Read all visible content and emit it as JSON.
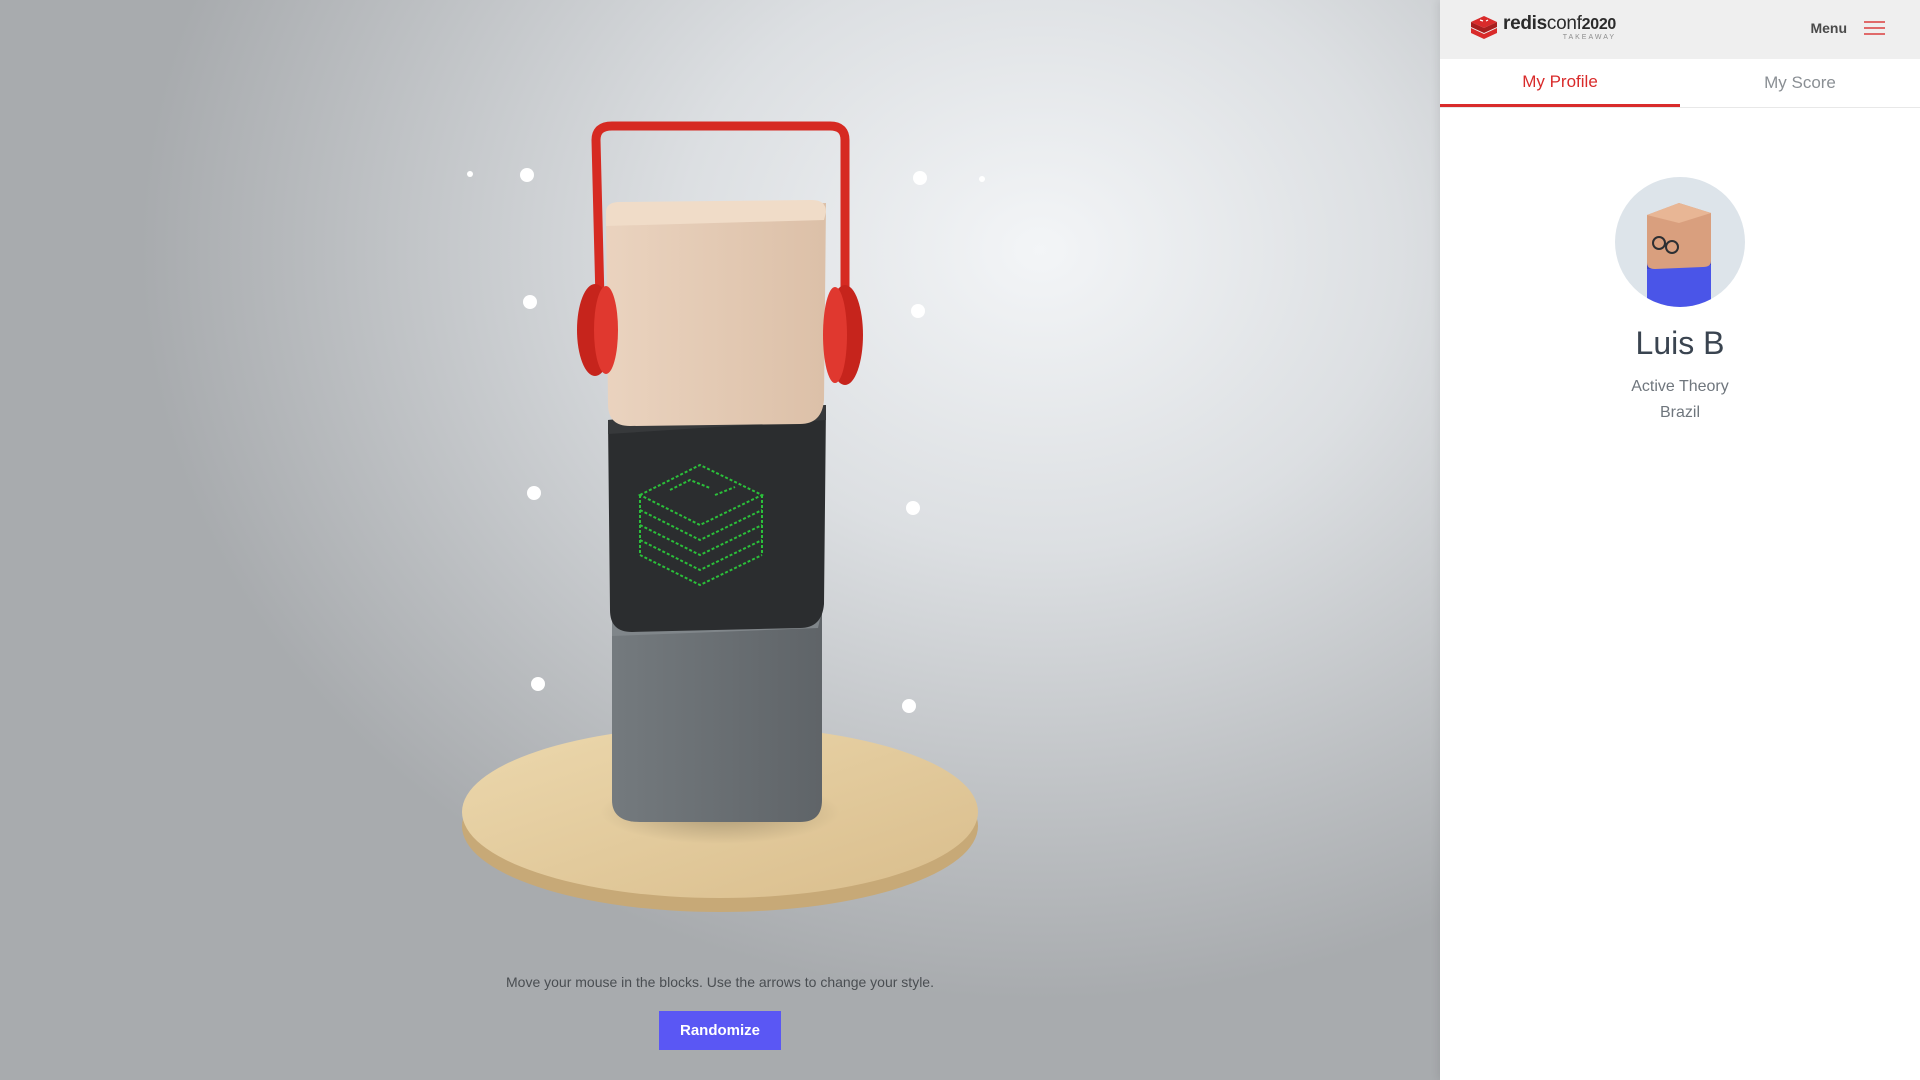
{
  "scene": {
    "hint": "Move your mouse in the blocks. Use the arrows to change your style.",
    "randomize_label": "Randomize"
  },
  "header": {
    "logo_brand": "redis",
    "logo_conf": "conf",
    "logo_year": "2020",
    "logo_sub": "TAKEAWAY",
    "menu_label": "Menu"
  },
  "tabs": [
    {
      "label": "My Profile",
      "active": true
    },
    {
      "label": "My Score",
      "active": false
    }
  ],
  "profile": {
    "name": "Luis B",
    "company": "Active Theory",
    "country": "Brazil"
  },
  "colors": {
    "accent": "#d92b2b",
    "button": "#5a57f4",
    "headphones": "#d62a22",
    "skin_block": "#e8cfb9",
    "dark_block": "#2b2d2f",
    "gray_block": "#6c7175",
    "logo_glow": "#27c93f"
  }
}
